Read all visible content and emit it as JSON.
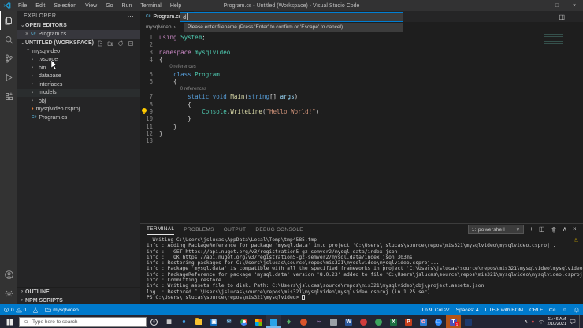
{
  "title_bar": {
    "title": "Program.cs - Untitled (Workspace) - Visual Studio Code",
    "menus": [
      "File",
      "Edit",
      "Selection",
      "View",
      "Go",
      "Run",
      "Terminal",
      "Help"
    ],
    "window_controls": {
      "minimize": "–",
      "maximize": "□",
      "close": "×"
    }
  },
  "activity_bar": {
    "items": [
      "explorer",
      "search",
      "source-control",
      "run-and-debug",
      "extensions"
    ],
    "bottom_items": [
      "account",
      "settings-gear"
    ]
  },
  "sidebar": {
    "header": "EXPLORER",
    "header_more": "⋯",
    "open_editors": {
      "label": "OPEN EDITORS",
      "items": [
        {
          "close": "×",
          "file": "Program.cs"
        }
      ]
    },
    "workspace": {
      "label": "UNTITLED (WORKSPACE)"
    },
    "tree": [
      {
        "label": "mysqlvideo",
        "icon": "chevron-down",
        "level": 0
      },
      {
        "label": ".vscode",
        "icon": "chevron-right",
        "level": 1
      },
      {
        "label": "bin",
        "icon": "chevron-right",
        "level": 1
      },
      {
        "label": "database",
        "icon": "chevron-right",
        "level": 1
      },
      {
        "label": "interfaces",
        "icon": "chevron-right",
        "level": 1
      },
      {
        "label": "models",
        "icon": "chevron-right",
        "level": 1,
        "hover": true
      },
      {
        "label": "obj",
        "icon": "chevron-right",
        "level": 1
      },
      {
        "label": "mysqlvideo.csproj",
        "icon": "csproj",
        "level": 1
      },
      {
        "label": "Program.cs",
        "icon": "cs",
        "level": 1
      }
    ],
    "bottom_sections": [
      "OUTLINE",
      "NPM SCRIPTS"
    ]
  },
  "editor": {
    "tab": {
      "label": "Program.cs",
      "close": "×"
    },
    "actions": {
      "split": "◫",
      "more": "⋯"
    },
    "breadcrumb": {
      "root": "mysqlvideo",
      "sep": "›"
    },
    "filename_input": {
      "value": "d",
      "prompt": "Please enter filename (Press 'Enter' to confirm or 'Escape' to cancel)"
    },
    "code": {
      "lines": [
        {
          "n": "1",
          "parts": [
            [
              "k",
              "using"
            ],
            [
              "p",
              " "
            ],
            [
              "t",
              "System"
            ],
            [
              "p",
              ";"
            ]
          ]
        },
        {
          "n": "2",
          "parts": []
        },
        {
          "n": "3",
          "parts": [
            [
              "k",
              "namespace"
            ],
            [
              "p",
              " "
            ],
            [
              "t",
              "mysqlvideo"
            ]
          ]
        },
        {
          "n": "4",
          "parts": [
            [
              "p",
              "{"
            ]
          ]
        },
        {
          "lens": "0 references",
          "pad": 4
        },
        {
          "n": "5",
          "parts": [
            [
              "p",
              "    "
            ],
            [
              "b",
              "class"
            ],
            [
              "p",
              " "
            ],
            [
              "t",
              "Program"
            ]
          ]
        },
        {
          "n": "6",
          "parts": [
            [
              "p",
              "    {"
            ]
          ]
        },
        {
          "lens": "0 references",
          "pad": 8
        },
        {
          "n": "7",
          "parts": [
            [
              "p",
              "        "
            ],
            [
              "b",
              "static"
            ],
            [
              "p",
              " "
            ],
            [
              "b",
              "void"
            ],
            [
              "p",
              " "
            ],
            [
              "y",
              "Main"
            ],
            [
              "p",
              "("
            ],
            [
              "b",
              "string"
            ],
            [
              "p",
              "[] "
            ],
            [
              "a",
              "args"
            ],
            [
              "p",
              ")"
            ]
          ]
        },
        {
          "n": "8",
          "parts": [
            [
              "p",
              "        {"
            ]
          ]
        },
        {
          "n": "9",
          "bulb": true,
          "parts": [
            [
              "p",
              "            "
            ],
            [
              "t",
              "Console"
            ],
            [
              "p",
              "."
            ],
            [
              "y",
              "WriteLine"
            ],
            [
              "p",
              "("
            ],
            [
              "s",
              "\"Hello World!\""
            ],
            [
              "p",
              ");"
            ]
          ]
        },
        {
          "n": "10",
          "parts": [
            [
              "p",
              "        }"
            ]
          ]
        },
        {
          "n": "11",
          "parts": [
            [
              "p",
              "    }"
            ]
          ]
        },
        {
          "n": "12",
          "parts": [
            [
              "p",
              "}"
            ]
          ]
        },
        {
          "n": "13",
          "parts": []
        }
      ]
    }
  },
  "panel": {
    "tabs": [
      "TERMINAL",
      "PROBLEMS",
      "OUTPUT",
      "DEBUG CONSOLE"
    ],
    "active_tab": "TERMINAL",
    "shell_select": {
      "value": "1: powershell",
      "chevron": "∨"
    },
    "actions": {
      "new": "+",
      "split": "◫",
      "kill": "trash",
      "maximize": "∧",
      "close": "×"
    },
    "terminal_lines": [
      "  Writing C:\\Users\\jslucas\\AppData\\Local\\Temp\\tmp4585.tmp",
      "info : Adding PackageReference for package 'mysql.data' into project 'C:\\Users\\jslucas\\source\\repos\\mis321\\mysqlvideo\\mysqlvideo.csproj'.",
      "info :   GET https://api.nuget.org/v3/registration5-gz-semver2/mysql.data/index.json",
      "info :   OK https://api.nuget.org/v3/registration5-gz-semver2/mysql.data/index.json 303ms",
      "info : Restoring packages for C:\\Users\\jslucas\\source\\repos\\mis321\\mysqlvideo\\mysqlvideo.csproj...",
      "info : Package 'mysql.data' is compatible with all the specified frameworks in project 'C:\\Users\\jslucas\\source\\repos\\mis321\\mysqlvideo\\mysqlvideo.csproj'.",
      "info : PackageReference for package 'mysql.data' version '8.0.23' added to file 'C:\\Users\\jslucas\\source\\repos\\mis321\\mysqlvideo\\mysqlvideo.csproj'.",
      "info : Committing restore...",
      "info : Writing assets file to disk. Path: C:\\Users\\jslucas\\source\\repos\\mis321\\mysqlvideo\\obj\\project.assets.json",
      "log  : Restored C:\\Users\\jslucas\\source\\repos\\mis321\\mysqlvideo\\mysqlvideo.csproj (in 1.25 sec).",
      "PS C:\\Users\\jslucas\\source\\repos\\mis321\\mysqlvideo> "
    ]
  },
  "status_bar": {
    "errors": "0",
    "warnings": "0",
    "project": "mysqlvideo",
    "line_col": "Ln 9, Col 27",
    "indent": "Spaces: 4",
    "encoding": "UTF-8 with BOM",
    "eol": "CRLF",
    "language": "C#",
    "accent": "#007acc"
  },
  "taskbar": {
    "search_placeholder": "Type here to search",
    "apps": [
      {
        "name": "cortana",
        "glyph": "○",
        "fg": "#e8e8e8",
        "bg": "transparent",
        "shape": "circle"
      },
      {
        "name": "task-view",
        "glyph": "▦",
        "fg": "#d8d8d8",
        "bg": "transparent"
      },
      {
        "name": "edge",
        "glyph": "e",
        "fg": "#45aaf2",
        "bg": "transparent"
      },
      {
        "name": "file-explorer",
        "kind": "folder"
      },
      {
        "name": "microsoft-store",
        "glyph": "▣",
        "fg": "#fff",
        "bg": "#0f6cbd"
      },
      {
        "name": "mail",
        "glyph": "✉",
        "fg": "#7ec3f0",
        "bg": "transparent"
      },
      {
        "name": "chrome",
        "kind": "chrome"
      },
      {
        "name": "photos-app",
        "kind": "photos"
      },
      {
        "name": "vscode",
        "glyph": "",
        "fg": "#fff",
        "bg": "#2aa3e8",
        "active": true
      },
      {
        "name": "sourcetree",
        "glyph": "◆",
        "fg": "#58b368",
        "bg": "transparent"
      },
      {
        "name": "opera-orange-app",
        "glyph": "",
        "fg": "#fff",
        "bg": "#d9542b",
        "shape": "circle"
      },
      {
        "name": "visual-studio",
        "glyph": "∞",
        "fg": "#b388cf",
        "bg": "transparent"
      },
      {
        "name": "gray-app",
        "glyph": "",
        "fg": "#fff",
        "bg": "#9aa0a6"
      },
      {
        "name": "word",
        "glyph": "W",
        "fg": "#fff",
        "bg": "#2b579a"
      },
      {
        "name": "minitab",
        "glyph": "",
        "fg": "#fff",
        "bg": "#cf3c3c",
        "shape": "circle"
      },
      {
        "name": "green-app",
        "glyph": "",
        "fg": "#fff",
        "bg": "#3da45c",
        "shape": "circle"
      },
      {
        "name": "excel",
        "glyph": "X",
        "fg": "#fff",
        "bg": "#1d6f42"
      },
      {
        "name": "powerpoint",
        "glyph": "P",
        "fg": "#fff",
        "bg": "#c43e1c"
      },
      {
        "name": "whiteboard-app",
        "glyph": "✿",
        "fg": "#f2a4c0",
        "bg": "#2d7dd2"
      },
      {
        "name": "zoom",
        "glyph": "□",
        "fg": "#fff",
        "bg": "#2d8cff",
        "shape": "circle"
      },
      {
        "name": "teams",
        "glyph": "T",
        "fg": "#fff",
        "bg": "#4b53bc",
        "attention": true,
        "badge": "1"
      },
      {
        "name": "navy-app",
        "glyph": "",
        "fg": "#fff",
        "bg": "#1d3a6e"
      }
    ],
    "tray": {
      "chevron": "∧",
      "time": "11:46 AM",
      "date": "2/10/2021"
    }
  }
}
